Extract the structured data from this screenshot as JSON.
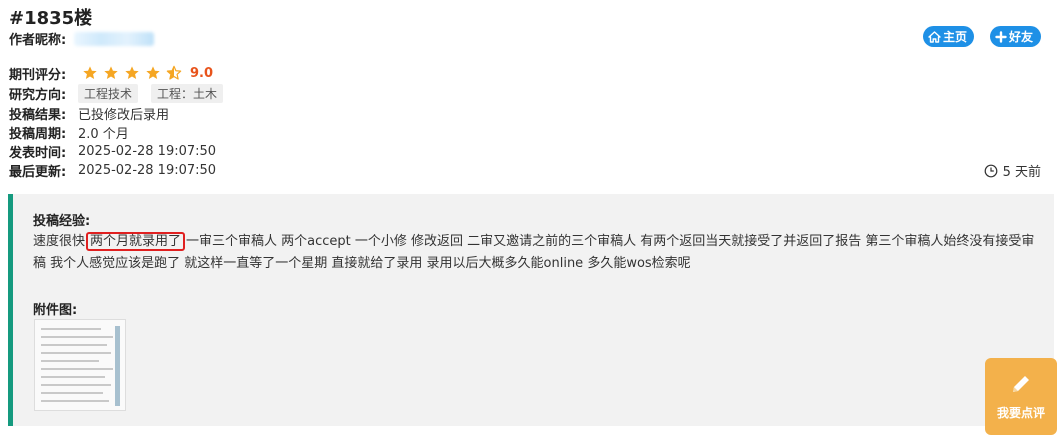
{
  "post": {
    "floor": "#1835楼",
    "author_label": "作者昵称:",
    "home_label": "主页",
    "friend_label": "好友"
  },
  "meta": {
    "rating_label": "期刊评分:",
    "rating_stars": 4.5,
    "rating_value": "9.0",
    "direction_label": "研究方向:",
    "tags": [
      "工程技术",
      "工程：土木"
    ],
    "result_label": "投稿结果:",
    "result_value": "已投修改后录用",
    "cycle_label": "投稿周期:",
    "cycle_value": "2.0 个月",
    "published_label": "发表时间:",
    "published_value": "2025-02-28 19:07:50",
    "updated_label": "最后更新:",
    "updated_value": "2025-02-28 19:07:50",
    "time_ago": "5 天前"
  },
  "experience": {
    "title": "投稿经验:",
    "text_before": "速度很快",
    "highlight": "两个月就录用了",
    "text_after": "一审三个审稿人 两个accept 一个小修 修改返回 二审又邀请之前的三个审稿人 有两个返回当天就接受了并返回了报告 第三个审稿人始终没有接受审稿 我个人感觉应该是跑了 就这样一直等了一个星期 直接就给了录用 录用以后大概多久能online 多久能wos检索呢",
    "attachment_title": "附件图:"
  },
  "actions": {
    "review_label": "我要点评"
  },
  "colors": {
    "accent_blue": "#1e90e6",
    "star": "#f5a623",
    "score": "#e8531b",
    "panel_border": "#159a7f",
    "highlight_border": "#e02020",
    "review_button": "#f3b14b"
  },
  "icons": {
    "home": "home-icon",
    "friend": "plus-icon",
    "clock": "clock-icon",
    "review": "pencil-icon"
  }
}
